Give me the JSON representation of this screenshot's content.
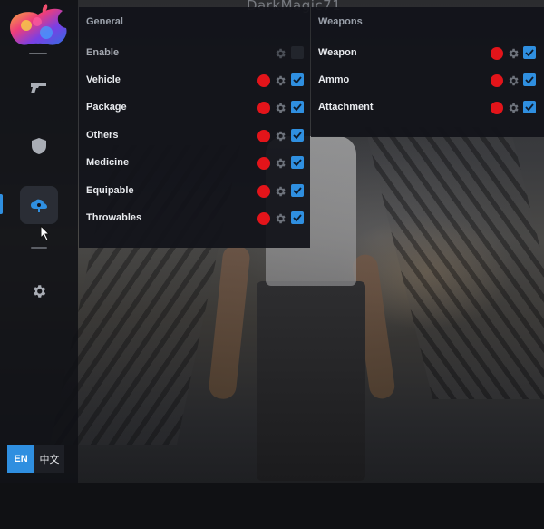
{
  "window": {
    "title": "DarkMagic71"
  },
  "colors": {
    "accent": "#2f8fe0",
    "alert": "#e3141a",
    "panel": "#121319"
  },
  "sidebar": {
    "items": [
      {
        "icon": "pistol-icon",
        "active": false
      },
      {
        "icon": "shield-icon",
        "active": false
      },
      {
        "icon": "cloud-pin-icon",
        "active": true
      },
      {
        "icon": "gear-icon",
        "active": false
      }
    ]
  },
  "language": {
    "options": [
      "EN",
      "中文"
    ],
    "selected": "EN"
  },
  "general": {
    "heading": "General",
    "rows": [
      {
        "label": "Enable",
        "red_dot": false,
        "checked": false
      },
      {
        "label": "Vehicle",
        "red_dot": true,
        "checked": true
      },
      {
        "label": "Package",
        "red_dot": true,
        "checked": true
      },
      {
        "label": "Others",
        "red_dot": true,
        "checked": true
      },
      {
        "label": "Medicine",
        "red_dot": true,
        "checked": true
      },
      {
        "label": "Equipable",
        "red_dot": true,
        "checked": true
      },
      {
        "label": "Throwables",
        "red_dot": true,
        "checked": true
      }
    ]
  },
  "weapons": {
    "heading": "Weapons",
    "rows": [
      {
        "label": "Weapon",
        "red_dot": true,
        "checked": true
      },
      {
        "label": "Ammo",
        "red_dot": true,
        "checked": true
      },
      {
        "label": "Attachment",
        "red_dot": true,
        "checked": true
      }
    ]
  }
}
